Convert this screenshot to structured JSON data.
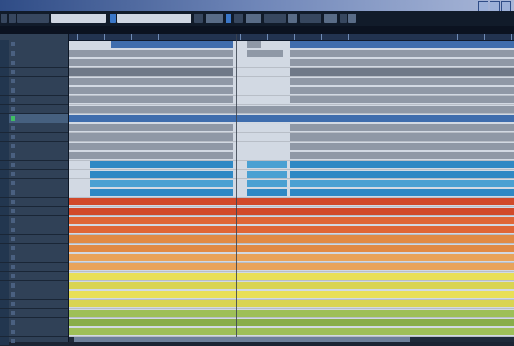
{
  "app": {
    "title": "",
    "title_color": "#ffffff"
  },
  "colors": {
    "cubase_blue": "#3b77c8",
    "red": "#d1492a",
    "orange": "#e18a45",
    "yellow": "#e9df56",
    "green": "#9ebf58",
    "cyan": "#2f88c4"
  },
  "toolbar": {
    "buttons": [
      {
        "name": "transport-button",
        "icon": "transport-icon"
      },
      {
        "name": "tempo-field",
        "icon": "tempo-icon"
      },
      {
        "name": "quantize-field",
        "icon": "quantize-icon"
      },
      {
        "name": "snap-button",
        "icon": "snap-icon"
      },
      {
        "name": "zoom-button",
        "icon": "zoom-icon"
      },
      {
        "name": "color-button",
        "icon": "color-icon"
      }
    ]
  },
  "tracks": [
    {
      "name": ""
    },
    {
      "name": ""
    },
    {
      "name": ""
    },
    {
      "name": ""
    },
    {
      "name": ""
    },
    {
      "name": ""
    },
    {
      "name": ""
    },
    {
      "name": ""
    },
    {
      "name": ""
    },
    {
      "name": ""
    },
    {
      "name": ""
    },
    {
      "name": ""
    },
    {
      "name": ""
    },
    {
      "name": ""
    },
    {
      "name": ""
    },
    {
      "name": ""
    },
    {
      "name": ""
    },
    {
      "name": ""
    },
    {
      "name": ""
    },
    {
      "name": ""
    },
    {
      "name": ""
    },
    {
      "name": ""
    },
    {
      "name": ""
    },
    {
      "name": ""
    },
    {
      "name": ""
    },
    {
      "name": ""
    },
    {
      "name": ""
    },
    {
      "name": ""
    },
    {
      "name": ""
    },
    {
      "name": ""
    },
    {
      "name": ""
    },
    {
      "name": ""
    },
    {
      "name": ""
    }
  ]
}
